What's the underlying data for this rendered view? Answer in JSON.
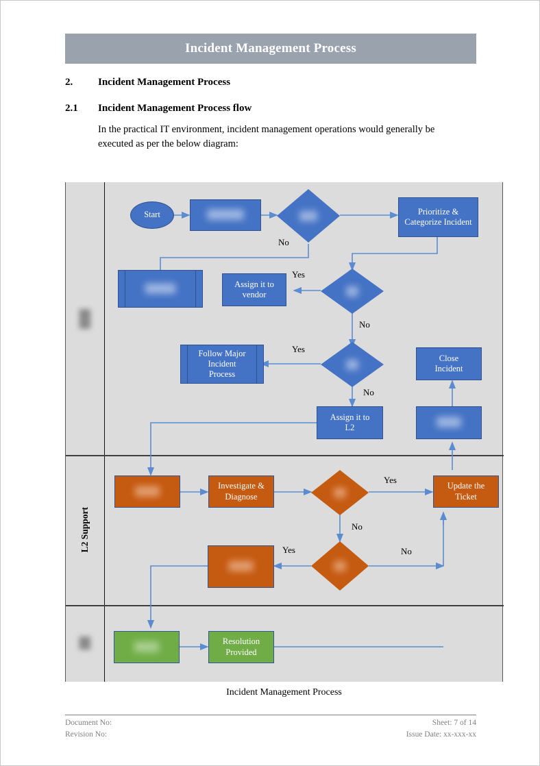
{
  "banner": {
    "title": "Incident Management Process"
  },
  "headings": {
    "h2_number": "2.",
    "h2_text": "Incident Management Process",
    "h3_number": "2.1",
    "h3_text": "Incident Management Process flow"
  },
  "paragraph": "In the practical IT environment, incident management operations would generally be executed as per the below diagram:",
  "diagram": {
    "caption": "Incident Management Process",
    "lanes": [
      {
        "label": "",
        "redacted": true
      },
      {
        "label": "L2 Support",
        "redacted": false
      },
      {
        "label": "",
        "redacted": true
      }
    ],
    "colors": {
      "lane_background": "#dcdcdc",
      "blue_fill": "#4472c4",
      "blue_border": "#2f528f",
      "orange_fill": "#c55a11",
      "green_fill": "#70ad47",
      "connector": "#5b8bd0",
      "banner": "#9aa2ae"
    },
    "nodes": {
      "start": "Start",
      "log_incident": "",
      "decision_1": "",
      "prioritize": "Prioritize &\nCategorize  Incident",
      "predef_left": "",
      "assign_vendor": "Assign it to\nvendor",
      "decision_vendor": "",
      "follow_major": "Follow Major\nIncident\nProcess",
      "decision_major": "",
      "assign_l2": "Assign it to\nL2",
      "close_incident": "Close\nIncident",
      "confirm_box": "",
      "l2_receive": "",
      "investigate": "Investigate  &\nDiagnose",
      "decision_resolved": "",
      "update_ticket": "Update  the\nTicket",
      "escalate_box": "",
      "decision_escalate": "",
      "green_left": "",
      "resolution_provided": "Resolution\nProvided"
    },
    "edge_labels": {
      "no_1": "No",
      "yes_vendor": "Yes",
      "no_vendor": "No",
      "yes_major": "Yes",
      "no_major": "No",
      "yes_resolved": "Yes",
      "no_resolved": "No",
      "yes_escalate": "Yes",
      "no_escalate": "No"
    }
  },
  "footer": {
    "document_no": "Document No:",
    "revision_no": "Revision No:",
    "sheet": "Sheet: 7 of 14",
    "issue_date": "Issue Date: xx-xxx-xx"
  }
}
